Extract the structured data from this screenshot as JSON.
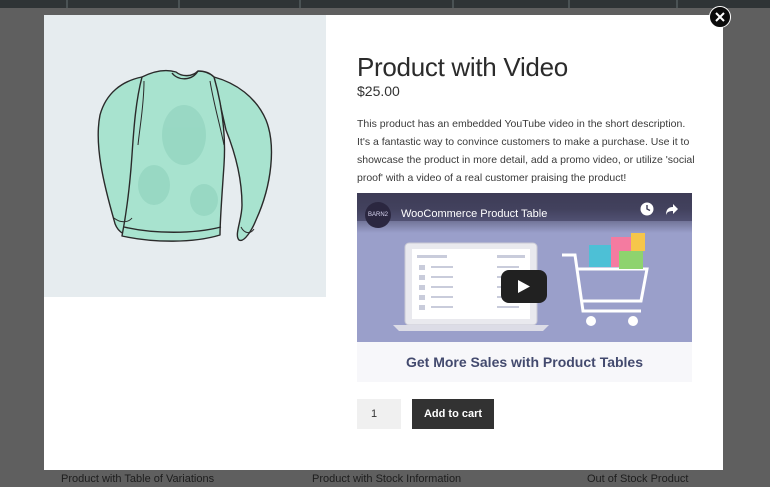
{
  "product": {
    "title": "Product with Video",
    "price": "$25.00",
    "description": "This product has an embedded YouTube video in the short description. It's a fantastic way to convince customers to make a purchase. Use it to showcase the product in more detail, add a promo video, or utilize 'social proof' with a video of a real customer praising the product!",
    "image_icon": "sweater-image"
  },
  "video": {
    "title": "WooCommerce Product Table",
    "channel_avatar_text": "BARN2",
    "caption": "Get More Sales with Product Tables",
    "play_icon": "play-icon",
    "watch_later_icon": "clock-icon",
    "share_icon": "share-icon"
  },
  "cart": {
    "quantity": "1",
    "add_label": "Add to cart"
  },
  "modal": {
    "close_icon": "close-icon"
  },
  "background": {
    "captions": [
      "Product with Table of Variations",
      "Product with Stock Information",
      "Out of Stock Product"
    ]
  },
  "colors": {
    "overlay": "#5f5f5f",
    "image_bg": "#e6ecef",
    "sweater": "#a8e3cf",
    "button": "#323232",
    "video_bg": "#9a9fca"
  }
}
